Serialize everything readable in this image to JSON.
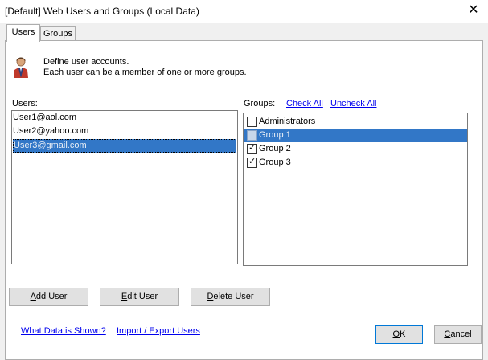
{
  "window": {
    "title": "[Default] Web Users and Groups (Local Data)",
    "close_glyph": "✕"
  },
  "tabs": [
    {
      "label": "Users",
      "active": true
    },
    {
      "label": "Groups",
      "active": false
    }
  ],
  "description": {
    "line1": "Define user accounts.",
    "line2": "Each user can be a member of one or more groups.",
    "icon": "user-icon"
  },
  "users": {
    "label": "Users:",
    "items": [
      {
        "label": "User1@aol.com",
        "selected": false
      },
      {
        "label": "User2@yahoo.com",
        "selected": false
      },
      {
        "label": "User3@gmail.com",
        "selected": true
      }
    ]
  },
  "groups": {
    "label": "Groups:",
    "check_all": "Check All",
    "uncheck_all": "Uncheck All",
    "items": [
      {
        "label": "Administrators",
        "checked": false,
        "selected": false
      },
      {
        "label": "Group 1",
        "checked": false,
        "selected": true
      },
      {
        "label": "Group 2",
        "checked": true,
        "selected": false
      },
      {
        "label": "Group 3",
        "checked": true,
        "selected": false
      }
    ]
  },
  "buttons": {
    "add_user": {
      "pre": "",
      "key": "A",
      "post": "dd User"
    },
    "edit_user": {
      "pre": "",
      "key": "E",
      "post": "dit User"
    },
    "delete_user": {
      "pre": "",
      "key": "D",
      "post": "elete User"
    },
    "ok": {
      "pre": "",
      "key": "O",
      "post": "K"
    },
    "cancel": {
      "pre": "",
      "key": "C",
      "post": "ancel"
    }
  },
  "footer": {
    "what_data": "What Data is Shown?",
    "import_export": "Import / Export Users"
  },
  "colors": {
    "selection": "#3277c7",
    "link": "#0000ee",
    "default_border": "#0078d7"
  }
}
